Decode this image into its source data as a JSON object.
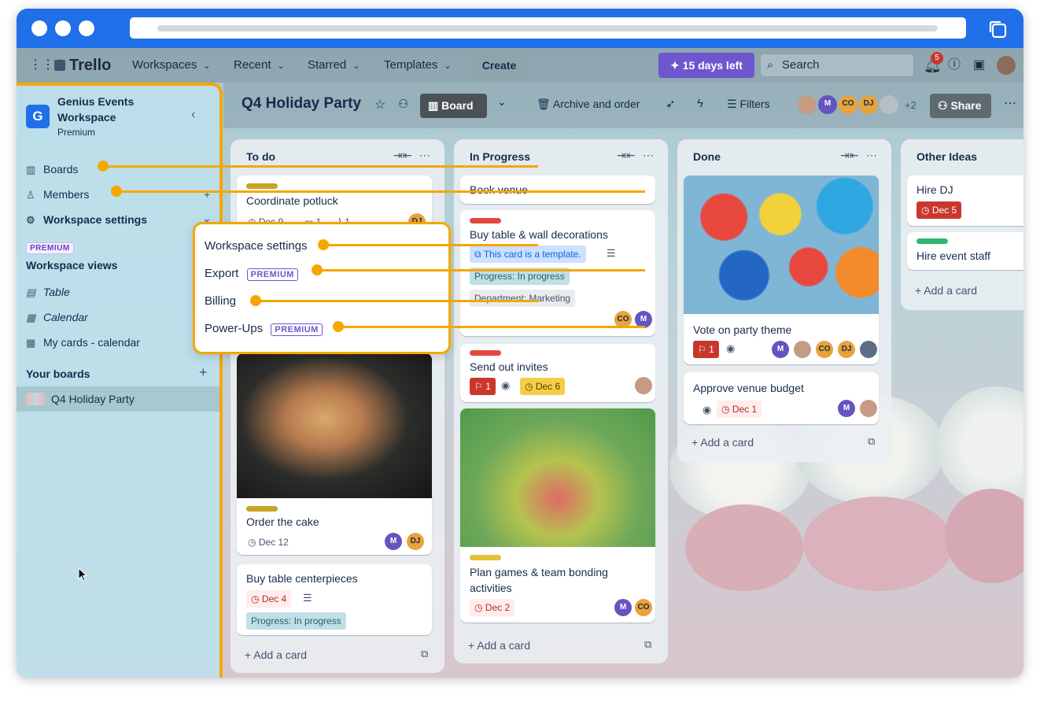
{
  "browser": {
    "url_placeholder": ""
  },
  "topnav": {
    "app_name": "Trello",
    "menus": [
      "Workspaces",
      "Recent",
      "Starred",
      "Templates"
    ],
    "create_label": "Create",
    "trial_label": "15 days left",
    "search_placeholder": "Search",
    "notification_count": "5"
  },
  "board": {
    "title": "Q4 Holiday Party",
    "view_label": "Board",
    "archive_label": "Archive and order",
    "filters_label": "Filters",
    "member_initials": [
      "M",
      "CO",
      "DJ"
    ],
    "extra_members": "+2",
    "share_label": "Share"
  },
  "sidebar": {
    "workspace_initial": "G",
    "workspace_name": "Genius Events Workspace",
    "workspace_plan": "Premium",
    "items": [
      {
        "label": "Boards",
        "icon": "board-icon"
      },
      {
        "label": "Members",
        "icon": "person-icon"
      },
      {
        "label": "Workspace settings",
        "icon": "gear-icon"
      }
    ],
    "premium_badge": "PREMIUM",
    "views_heading": "Workspace views",
    "views": [
      {
        "label": "Table",
        "icon": "table-icon"
      },
      {
        "label": "Calendar",
        "icon": "calendar-icon"
      },
      {
        "label": "My cards - calendar",
        "icon": "calendar-icon"
      }
    ],
    "boards_heading": "Your boards",
    "boards": [
      {
        "label": "Q4 Holiday Party"
      }
    ]
  },
  "popover": {
    "items": [
      {
        "label": "Workspace settings",
        "badge": ""
      },
      {
        "label": "Export",
        "badge": "PREMIUM"
      },
      {
        "label": "Billing",
        "badge": ""
      },
      {
        "label": "Power-Ups",
        "badge": "PREMIUM"
      }
    ]
  },
  "lists": {
    "todo": {
      "title": "To do",
      "cards": [
        {
          "title": "Coordinate potluck",
          "date": "Dec 9",
          "comments": "1",
          "attachments": "1",
          "member": "DJ"
        },
        {
          "title": "Order the cake",
          "date": "Dec 12",
          "members": [
            "M",
            "DJ"
          ]
        },
        {
          "title": "Buy table centerpieces",
          "date": "Dec 4",
          "field": "Progress: In progress"
        }
      ],
      "add_label": "Add a card"
    },
    "inprogress": {
      "title": "In Progress",
      "cards": [
        {
          "title": "Book venue"
        },
        {
          "title": "Buy table & wall decorations",
          "template_note": "This card is a template.",
          "field1": "Progress: In progress",
          "field2": "Department: Marketing",
          "members": [
            "CO",
            "M"
          ]
        },
        {
          "title": "Send out invites",
          "votes": "1",
          "date": "Dec 6"
        },
        {
          "title": "Plan games & team bonding activities",
          "date": "Dec 2",
          "members": [
            "M",
            "CO"
          ]
        }
      ],
      "add_label": "Add a card"
    },
    "done": {
      "title": "Done",
      "cards": [
        {
          "title": "Vote on party theme",
          "votes": "1",
          "members": [
            "M",
            "CO",
            "DJ"
          ]
        },
        {
          "title": "Approve venue budget",
          "date": "Dec 1",
          "members": [
            "M"
          ]
        }
      ],
      "add_label": "Add a card"
    },
    "other": {
      "title": "Other Ideas",
      "cards": [
        {
          "title": "Hire DJ",
          "date": "Dec 5"
        },
        {
          "title": "Hire event staff"
        }
      ],
      "add_label": "Add a card"
    }
  },
  "colors": {
    "accent": "#f5a700",
    "browser_blue": "#1f6fe8",
    "trial_purple": "#6e56cf",
    "overdue_red": "#c9372c"
  }
}
